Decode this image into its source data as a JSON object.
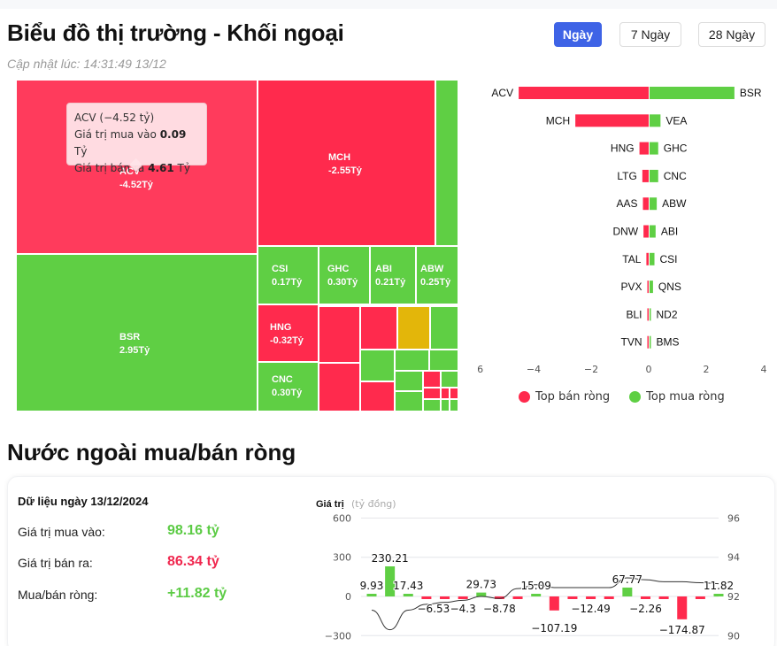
{
  "header": {
    "title": "Biểu đồ thị trường - Khối ngoại",
    "updated": "Cập nhật lúc: 14:31:49 13/12",
    "range_buttons": [
      {
        "label": "Ngày",
        "active": true
      },
      {
        "label": "7 Ngày",
        "active": false
      },
      {
        "label": "28 Ngày",
        "active": false
      }
    ]
  },
  "colors": {
    "sell": "#ff2a4d",
    "buy": "#5fcf44",
    "neutral": "#e3b60a",
    "accent": "#3e63e6"
  },
  "treemap": {
    "unit": "Tỷ",
    "labeled_cells": [
      {
        "ticker": "ACV",
        "value_label": "-4.52Tỷ"
      },
      {
        "ticker": "MCH",
        "value_label": "-2.55Tỷ"
      },
      {
        "ticker": "BSR",
        "value_label": "2.95Tỷ"
      },
      {
        "ticker": "CSI",
        "value_label": "0.17Tỷ"
      },
      {
        "ticker": "GHC",
        "value_label": "0.30Tỷ"
      },
      {
        "ticker": "ABI",
        "value_label": "0.21Tỷ"
      },
      {
        "ticker": "ABW",
        "value_label": "0.25Tỷ"
      },
      {
        "ticker": "HNG",
        "value_label": "-0.32Tỷ"
      },
      {
        "ticker": "CNC",
        "value_label": "0.30Tỷ"
      }
    ],
    "tooltip": {
      "title": "ACV (−4.52 tỷ)",
      "buy_label": "Giá trị mua vào",
      "buy_value": "0.09",
      "sell_label": "Giá trị bán ra",
      "sell_value": "4.61",
      "unit": "Tỷ"
    }
  },
  "chart_data": [
    {
      "type": "bar",
      "title": "Top bán ròng / Top mua ròng",
      "orientation": "horizontal-diverging",
      "xlim": [
        -6,
        4
      ],
      "x_ticks": [
        "−6",
        "−4",
        "−2",
        "0",
        "2",
        "4"
      ],
      "legend": [
        "Top bán ròng",
        "Top mua ròng"
      ],
      "legend_position": "bottom",
      "rows": [
        {
          "sell": "ACV",
          "sell_value": -4.52,
          "buy": "BSR",
          "buy_value": 2.95
        },
        {
          "sell": "MCH",
          "sell_value": -2.55,
          "buy": "VEA",
          "buy_value": 0.38
        },
        {
          "sell": "HNG",
          "sell_value": -0.32,
          "buy": "GHC",
          "buy_value": 0.3
        },
        {
          "sell": "LTG",
          "sell_value": -0.22,
          "buy": "CNC",
          "buy_value": 0.3
        },
        {
          "sell": "AAS",
          "sell_value": -0.2,
          "buy": "ABW",
          "buy_value": 0.25
        },
        {
          "sell": "DNW",
          "sell_value": -0.18,
          "buy": "ABI",
          "buy_value": 0.21
        },
        {
          "sell": "TAL",
          "sell_value": -0.08,
          "buy": "CSI",
          "buy_value": 0.17
        },
        {
          "sell": "PVX",
          "sell_value": -0.01,
          "buy": "QNS",
          "buy_value": 0.12
        },
        {
          "sell": "BLI",
          "sell_value": -0.01,
          "buy": "ND2",
          "buy_value": 0.03
        },
        {
          "sell": "TVN",
          "sell_value": -0.01,
          "buy": "BMS",
          "buy_value": 0.03
        }
      ]
    },
    {
      "type": "bar",
      "title": "Giá trị",
      "ylabel_unit": "(tỷ đồng)",
      "ylim": [
        -300,
        600
      ],
      "y_ticks": [
        "600",
        "300",
        "0",
        "−300"
      ],
      "y2_ticks": [
        "96",
        "94",
        "92",
        "90"
      ],
      "y2lim": [
        90,
        96
      ],
      "values": [
        9.93,
        230.21,
        17.43,
        -6.53,
        -6.53,
        -4.3,
        29.73,
        -8.78,
        -8.78,
        15.09,
        -107.19,
        -12.49,
        -12.49,
        -12.49,
        67.77,
        -2.26,
        -12.0,
        -174.87,
        -20.0,
        11.82
      ],
      "labels": [
        "9.93",
        "230.21",
        "17.43",
        "−6.53",
        "",
        "−4.3",
        "29.73",
        "−8.78",
        "",
        "15.09",
        "−107.19",
        "",
        "−12.49",
        "",
        "67.77",
        "−2.26",
        "",
        "−174.87",
        "",
        "11.82"
      ],
      "line_series": [
        91.3,
        90.3,
        91.3,
        91.6,
        91.7,
        91.8,
        92.0,
        91.9,
        92.4,
        92.6,
        92.45,
        92.45,
        92.45,
        92.45,
        92.95,
        92.85,
        92.75,
        92.75,
        92.7,
        92.65
      ]
    }
  ],
  "section2": {
    "title": "Nước ngoài mua/bán ròng",
    "date_label": "Dữ liệu ngày 13/12/2024",
    "rows": [
      {
        "label": "Giá trị mua vào:",
        "value": "98.16 tỷ",
        "sign": "pos"
      },
      {
        "label": "Giá trị bán ra:",
        "value": "86.34 tỷ",
        "sign": "neg"
      },
      {
        "label": "Mua/bán ròng:",
        "value": "+11.82 tỷ",
        "sign": "pos"
      }
    ],
    "chart_title": "Giá trị",
    "chart_unit": "(tỷ đồng)"
  }
}
